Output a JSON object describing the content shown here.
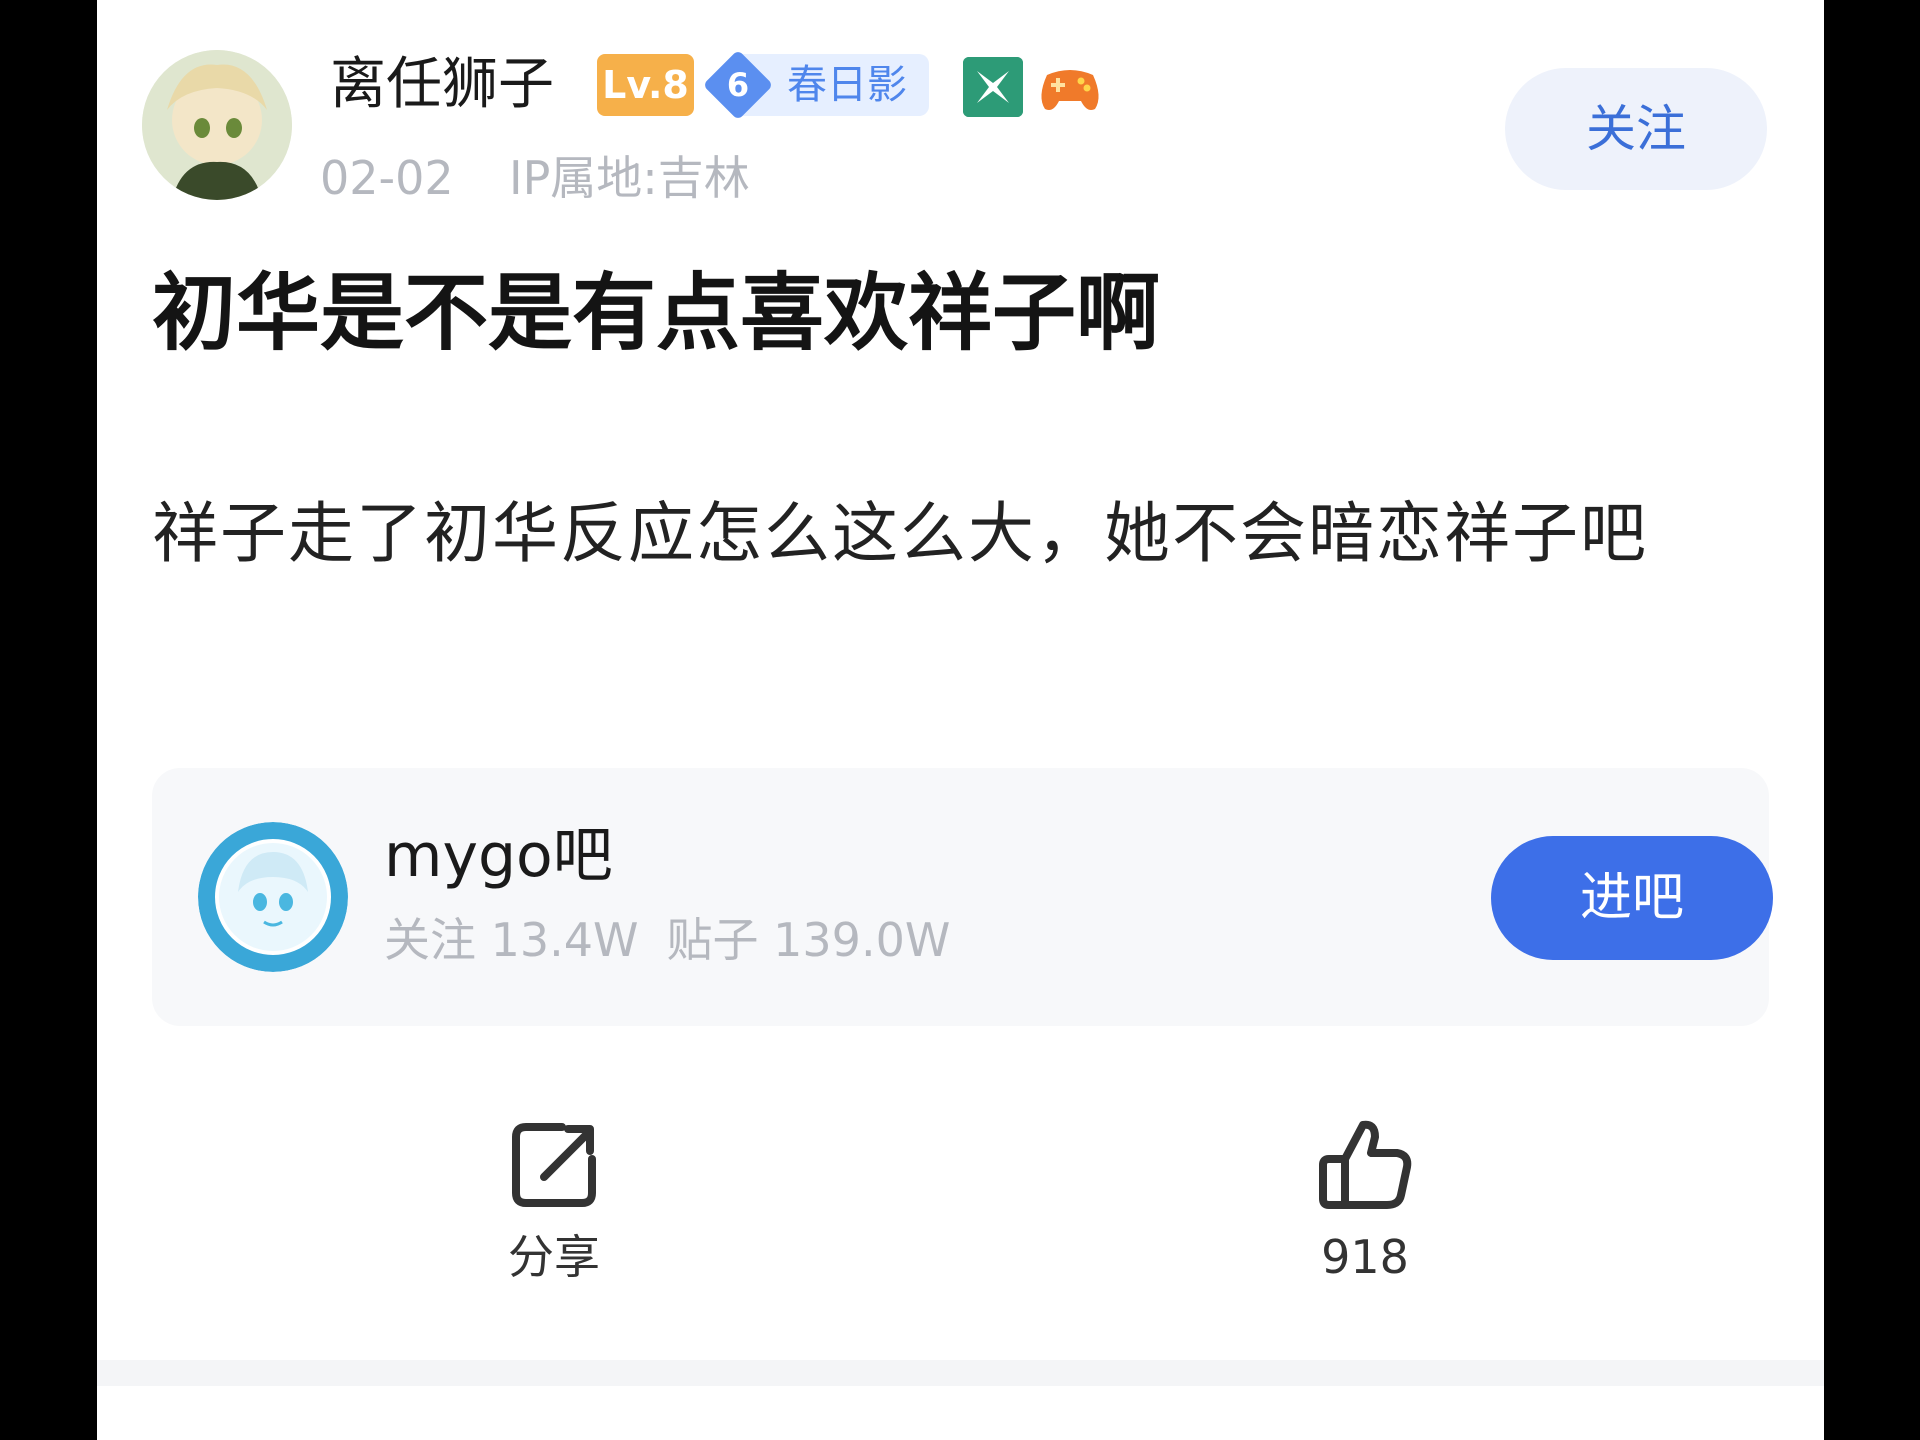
{
  "post": {
    "author": {
      "name": "离任狮子",
      "level_badge": "Lv.8",
      "rank_number": "6",
      "rank_title": "春日影",
      "follow_label": "关注"
    },
    "date": "02-02",
    "ip_location": "IP属地:吉林",
    "title": "初华是不是有点喜欢祥子啊",
    "body": "祥子走了初华反应怎么这么大，她不会暗恋祥子吧"
  },
  "forum": {
    "name": "mygo吧",
    "followers": "关注 13.4W",
    "posts": "贴子 139.0W",
    "enter_label": "进吧"
  },
  "actions": {
    "share_label": "分享",
    "like_count": "918"
  },
  "colors": {
    "accent": "#3d6fe8",
    "level_badge": "#f6b04a",
    "rank_badge": "#5b8ff0",
    "muted_text": "#b5b8bf"
  },
  "icons": {
    "share": "share-icon",
    "like": "thumbs-up-icon",
    "special_badge": "green-square-badge-icon",
    "game": "gamepad-icon"
  }
}
